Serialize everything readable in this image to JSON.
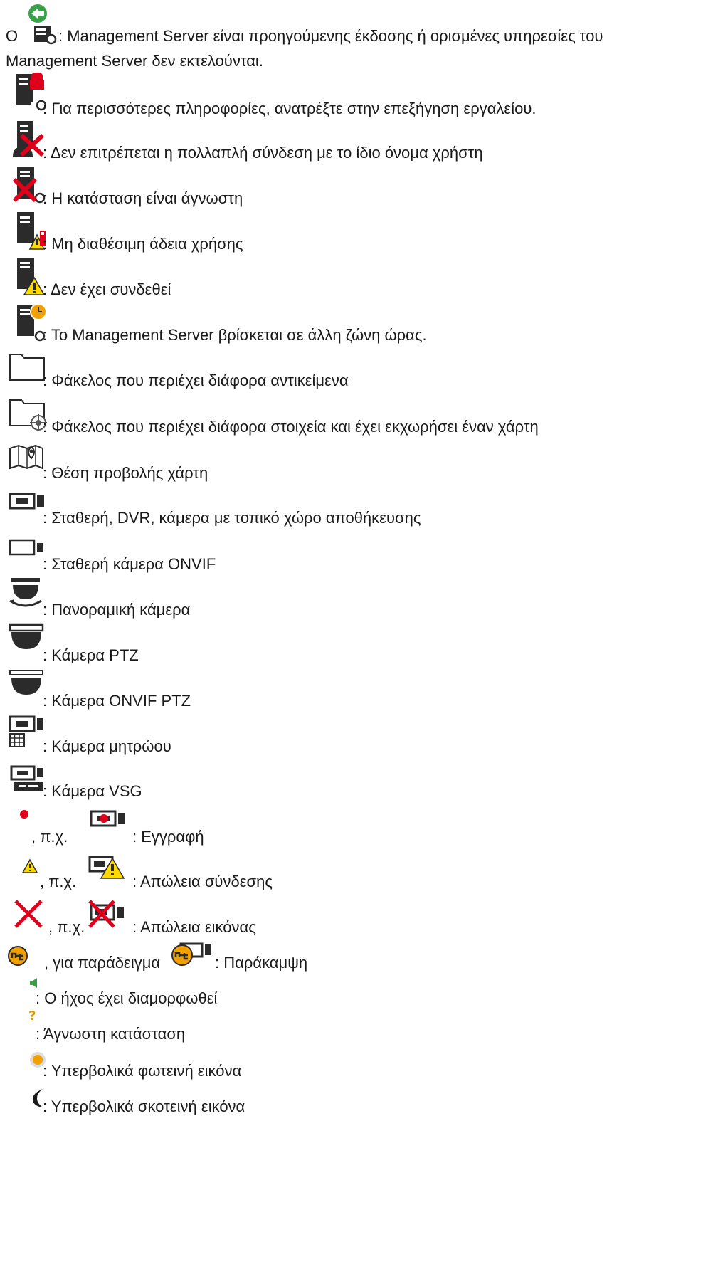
{
  "items": [
    {
      "icon": "server-legacy-icon",
      "text": "Ο ",
      "text2": ": Management Server είναι προηγούμενης έκδοσης ή ορισμένες υπηρεσίες του",
      "text3": "Management Server δεν εκτελούνται."
    },
    {
      "icon": "server-info-lock-icon",
      "text": ": Για περισσότερες πληροφορίες, ανατρέξτε στην επεξήγηση εργαλείου."
    },
    {
      "icon": "server-user-multi-login-denied-icon",
      "text": ": Δεν επιτρέπεται η πολλαπλή σύνδεση με το ίδιο όνομα χρήστη"
    },
    {
      "icon": "server-unknown-state-icon",
      "text": ": Η κατάσταση είναι άγνωστη"
    },
    {
      "icon": "server-no-license-icon",
      "text": ": Μη διαθέσιμη άδεια χρήσης"
    },
    {
      "icon": "server-not-connected-icon",
      "text": ": Δεν έχει συνδεθεί"
    },
    {
      "icon": "server-timezone-icon",
      "text": ": Το Management Server βρίσκεται σε άλλη ζώνη ώρας."
    },
    {
      "icon": "folder-icon",
      "text": ": Φάκελος που περιέχει διάφορα αντικείμενα"
    },
    {
      "icon": "folder-map-icon",
      "text": ": Φάκελος που περιέχει διάφορα στοιχεία και έχει εκχωρήσει έναν χάρτη"
    },
    {
      "icon": "map-view-position-icon",
      "text": ": Θέση προβολής χάρτη"
    },
    {
      "icon": "fixed-camera-icon",
      "text": ": Σταθερή, DVR, κάμερα με τοπικό χώρο αποθήκευσης"
    },
    {
      "icon": "onvif-fixed-camera-icon",
      "text": ": Σταθερή κάμερα ONVIF"
    },
    {
      "icon": "panoramic-camera-icon",
      "text": ": Πανοραμική κάμερα"
    },
    {
      "icon": "ptz-camera-icon",
      "text": ": Κάμερα PTZ"
    },
    {
      "icon": "onvif-ptz-camera-icon",
      "text": ": Κάμερα ONVIF PTZ"
    },
    {
      "icon": "matrix-camera-icon",
      "text": ": Κάμερα μητρώου"
    },
    {
      "icon": "vsg-camera-icon",
      "text": ": Κάμερα VSG"
    }
  ],
  "examples": {
    "recording": {
      "mid": ", π.χ.",
      "text": ": Εγγραφή"
    },
    "connection_lost": {
      "mid": ", π.χ.",
      "text": ": Απώλεια σύνδεσης"
    },
    "image_lost": {
      "mid": ", π.χ.",
      "text": ": Απώλεια εικόνας"
    },
    "bypass": {
      "mid": ", για παράδειγμα",
      "text": ": Παράκαμψη"
    }
  },
  "tail": {
    "audio": ": Ο ήχος έχει διαμορφωθεί",
    "unknown": ": Άγνωστη κατάσταση",
    "too_bright": ": Υπερβολικά φωτεινή εικόνα",
    "too_dark": ": Υπερβολικά σκοτεινή εικόνα"
  },
  "colors": {
    "dark": "#2b2b2b",
    "red": "#e0001b",
    "green": "#3aa14a",
    "yellow": "#ffd800",
    "orange": "#f2a000",
    "blue": "#2f6f9f"
  }
}
